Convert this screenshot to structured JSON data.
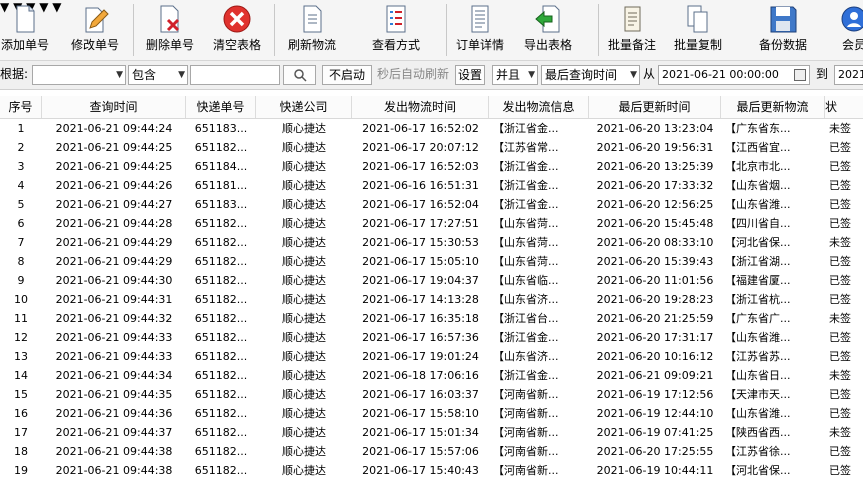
{
  "toolbar": {
    "buttons": [
      {
        "label": "添加单号",
        "icon": "document-icon"
      },
      {
        "label": "修改单号",
        "icon": "edit-pencil-icon"
      },
      {
        "label": "删除单号",
        "icon": "delete-document-icon"
      },
      {
        "label": "清空表格",
        "icon": "clear-red-x-icon"
      },
      {
        "label": "刷新物流",
        "icon": "refresh-document-icon"
      },
      {
        "label": "查看方式",
        "icon": "view-mode-icon"
      },
      {
        "label": "订单详情",
        "icon": "order-detail-icon"
      },
      {
        "label": "导出表格",
        "icon": "export-green-arrow-icon"
      },
      {
        "label": "批量备注",
        "icon": "scroll-note-icon"
      },
      {
        "label": "批量复制",
        "icon": "copy-document-icon"
      },
      {
        "label": "备份数据",
        "icon": "floppy-disk-icon"
      },
      {
        "label": "会员",
        "icon": "member-icon"
      }
    ]
  },
  "filter": {
    "label": "根据:",
    "field_value": "",
    "match_mode": "包含",
    "keyword": "",
    "auto_refresh_button": "不启动",
    "auto_refresh_hint": "秒后自动刷新",
    "settings_button": "设置",
    "logic": "并且",
    "date_field": "最后查询时间",
    "from_label": "从",
    "from_value": "2021-06-21 00:00:00",
    "to_label": "到",
    "to_value": "2021"
  },
  "table": {
    "columns": [
      "序号",
      "查询时间",
      "快递单号",
      "快递公司",
      "发出物流时间",
      "发出物流信息",
      "最后更新时间",
      "最后更新物流",
      "状"
    ],
    "rows": [
      [
        "1",
        "2021-06-21 09:44:24",
        "651183...",
        "顺心捷达",
        "2021-06-17 16:52:02",
        "【浙江省金...",
        "2021-06-20 13:23:04",
        "【广东省东...",
        "未签"
      ],
      [
        "2",
        "2021-06-21 09:44:25",
        "651182...",
        "顺心捷达",
        "2021-06-17 20:07:12",
        "【江苏省常...",
        "2021-06-20 19:56:31",
        "【江西省宜...",
        "已签"
      ],
      [
        "3",
        "2021-06-21 09:44:25",
        "651184...",
        "顺心捷达",
        "2021-06-17 16:52:03",
        "【浙江省金...",
        "2021-06-20 13:25:39",
        "【北京市北...",
        "已签"
      ],
      [
        "4",
        "2021-06-21 09:44:26",
        "651181...",
        "顺心捷达",
        "2021-06-16 16:51:31",
        "【浙江省金...",
        "2021-06-20 17:33:32",
        "【山东省烟...",
        "已签"
      ],
      [
        "5",
        "2021-06-21 09:44:27",
        "651183...",
        "顺心捷达",
        "2021-06-17 16:52:04",
        "【浙江省金...",
        "2021-06-20 12:56:25",
        "【山东省潍...",
        "已签"
      ],
      [
        "6",
        "2021-06-21 09:44:28",
        "651182...",
        "顺心捷达",
        "2021-06-17 17:27:51",
        "【山东省菏...",
        "2021-06-20 15:45:48",
        "【四川省自...",
        "已签"
      ],
      [
        "7",
        "2021-06-21 09:44:29",
        "651182...",
        "顺心捷达",
        "2021-06-17 15:30:53",
        "【山东省菏...",
        "2021-06-20 08:33:10",
        "【河北省保...",
        "未签"
      ],
      [
        "8",
        "2021-06-21 09:44:29",
        "651182...",
        "顺心捷达",
        "2021-06-17 15:05:10",
        "【山东省菏...",
        "2021-06-20 15:39:43",
        "【浙江省湖...",
        "已签"
      ],
      [
        "9",
        "2021-06-21 09:44:30",
        "651182...",
        "顺心捷达",
        "2021-06-17 19:04:37",
        "【山东省临...",
        "2021-06-20 11:01:56",
        "【福建省厦...",
        "已签"
      ],
      [
        "10",
        "2021-06-21 09:44:31",
        "651182...",
        "顺心捷达",
        "2021-06-17 14:13:28",
        "【山东省济...",
        "2021-06-20 19:28:23",
        "【浙江省杭...",
        "已签"
      ],
      [
        "11",
        "2021-06-21 09:44:32",
        "651182...",
        "顺心捷达",
        "2021-06-17 16:35:18",
        "【浙江省台...",
        "2021-06-20 21:25:59",
        "【广东省广...",
        "未签"
      ],
      [
        "12",
        "2021-06-21 09:44:33",
        "651182...",
        "顺心捷达",
        "2021-06-17 16:57:36",
        "【浙江省金...",
        "2021-06-20 17:31:17",
        "【山东省潍...",
        "已签"
      ],
      [
        "13",
        "2021-06-21 09:44:33",
        "651182...",
        "顺心捷达",
        "2021-06-17 19:01:24",
        "【山东省济...",
        "2021-06-20 10:16:12",
        "【江苏省苏...",
        "已签"
      ],
      [
        "14",
        "2021-06-21 09:44:34",
        "651182...",
        "顺心捷达",
        "2021-06-18 17:06:16",
        "【浙江省金...",
        "2021-06-21 09:09:21",
        "【山东省日...",
        "未签"
      ],
      [
        "15",
        "2021-06-21 09:44:35",
        "651182...",
        "顺心捷达",
        "2021-06-17 16:03:37",
        "【河南省新...",
        "2021-06-19 17:12:56",
        "【天津市天...",
        "已签"
      ],
      [
        "16",
        "2021-06-21 09:44:36",
        "651182...",
        "顺心捷达",
        "2021-06-17 15:58:10",
        "【河南省新...",
        "2021-06-19 12:44:10",
        "【山东省潍...",
        "已签"
      ],
      [
        "17",
        "2021-06-21 09:44:37",
        "651182...",
        "顺心捷达",
        "2021-06-17 15:01:34",
        "【河南省新...",
        "2021-06-19 07:41:25",
        "【陕西省西...",
        "未签"
      ],
      [
        "18",
        "2021-06-21 09:44:38",
        "651182...",
        "顺心捷达",
        "2021-06-17 15:57:06",
        "【河南省新...",
        "2021-06-20 17:25:55",
        "【江苏省徐...",
        "已签"
      ],
      [
        "19",
        "2021-06-21 09:44:38",
        "651182...",
        "顺心捷达",
        "2021-06-17 15:40:43",
        "【河南省新...",
        "2021-06-19 10:44:11",
        "【河北省保...",
        "已签"
      ]
    ]
  }
}
